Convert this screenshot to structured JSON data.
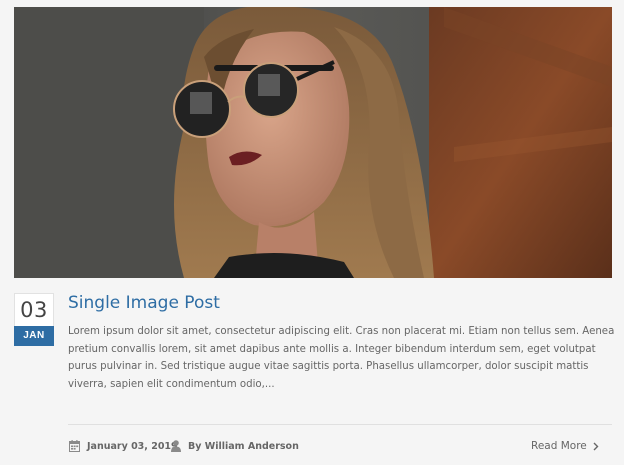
{
  "post": {
    "image_alt": "woman-wearing-sunglasses-photo",
    "date_day": "03",
    "date_month": "JAN",
    "title": "Single Image Post",
    "excerpt": "Lorem ipsum dolor sit amet, consectetur adipiscing elit. Cras non placerat mi. Etiam non tellus sem. Aenea pretium convallis lorem, sit amet dapibus ante mollis a. Integer bibendum interdum sem, eget volutpat purus pulvinar in. Sed tristique augue vitae sagittis porta. Phasellus ullamcorper, dolor suscipit mattis viverra, sapien elit condimentum odio,...",
    "meta_date": "January 03, 2019",
    "meta_author": "By William Anderson",
    "read_more": "Read More"
  },
  "icons": {
    "calendar": "calendar-icon",
    "user": "user-icon",
    "chevron": "chevron-right-icon"
  },
  "colors": {
    "accent": "#2e6da4",
    "text": "#666666",
    "background": "#f5f5f5"
  }
}
